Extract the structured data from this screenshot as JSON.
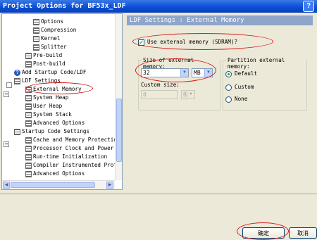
{
  "window": {
    "title": "Project Options for BF53x_LDF",
    "help_label": "?"
  },
  "tree": {
    "items": [
      {
        "label": "Options",
        "level": 3,
        "icon": "page-icon"
      },
      {
        "label": "Compression",
        "level": 3,
        "icon": "page-icon"
      },
      {
        "label": "Kernel",
        "level": 3,
        "icon": "page-icon"
      },
      {
        "label": "Splitter",
        "level": 3,
        "icon": "page-icon"
      },
      {
        "label": "Pre-build",
        "level": 2,
        "icon": "page-icon"
      },
      {
        "label": "Post-build",
        "level": 2,
        "icon": "page-icon"
      },
      {
        "label": "Add Startup Code/LDF",
        "level": 1,
        "icon": "help-icon"
      },
      {
        "label": "LDF Settings",
        "level": 1,
        "icon": "page-icon",
        "expander": "−"
      },
      {
        "label": "External Memory",
        "level": 2,
        "icon": "page-icon"
      },
      {
        "label": "System Heap",
        "level": 2,
        "icon": "page-icon"
      },
      {
        "label": "User Heap",
        "level": 2,
        "icon": "page-icon"
      },
      {
        "label": "System Stack",
        "level": 2,
        "icon": "page-icon"
      },
      {
        "label": "Advanced Options",
        "level": 2,
        "icon": "page-icon"
      },
      {
        "label": "Startup Code Settings",
        "level": 1,
        "icon": "page-icon",
        "expander": "−"
      },
      {
        "label": "Cache and Memory Protection",
        "level": 2,
        "icon": "page-icon"
      },
      {
        "label": "Processor Clock and Power S",
        "level": 2,
        "icon": "page-icon"
      },
      {
        "label": "Run-time Initialization",
        "level": 2,
        "icon": "page-icon"
      },
      {
        "label": "Compiler Instrumented Prof",
        "level": 2,
        "icon": "page-icon"
      },
      {
        "label": "Advanced Options",
        "level": 2,
        "icon": "page-icon"
      }
    ]
  },
  "panel": {
    "header": "LDF Settings : External Memory",
    "use_ext_label": "Use external memory (SDRAM)?",
    "size_group_label": "Size of external memory:",
    "size_value": "32",
    "size_unit": "MB",
    "custom_size_label": "Custom size:",
    "custom_size_value": "0",
    "custom_size_unit": "B",
    "partition_label": "Partition external memory:",
    "partition_options": [
      "Default",
      "Custom",
      "None"
    ]
  },
  "buttons": {
    "ok": "确定",
    "cancel": "取消"
  },
  "colors": {
    "title_bar": "#0a4fd6",
    "header_bar": "#8fa5c9",
    "highlight_oval": "#d21b1b"
  }
}
